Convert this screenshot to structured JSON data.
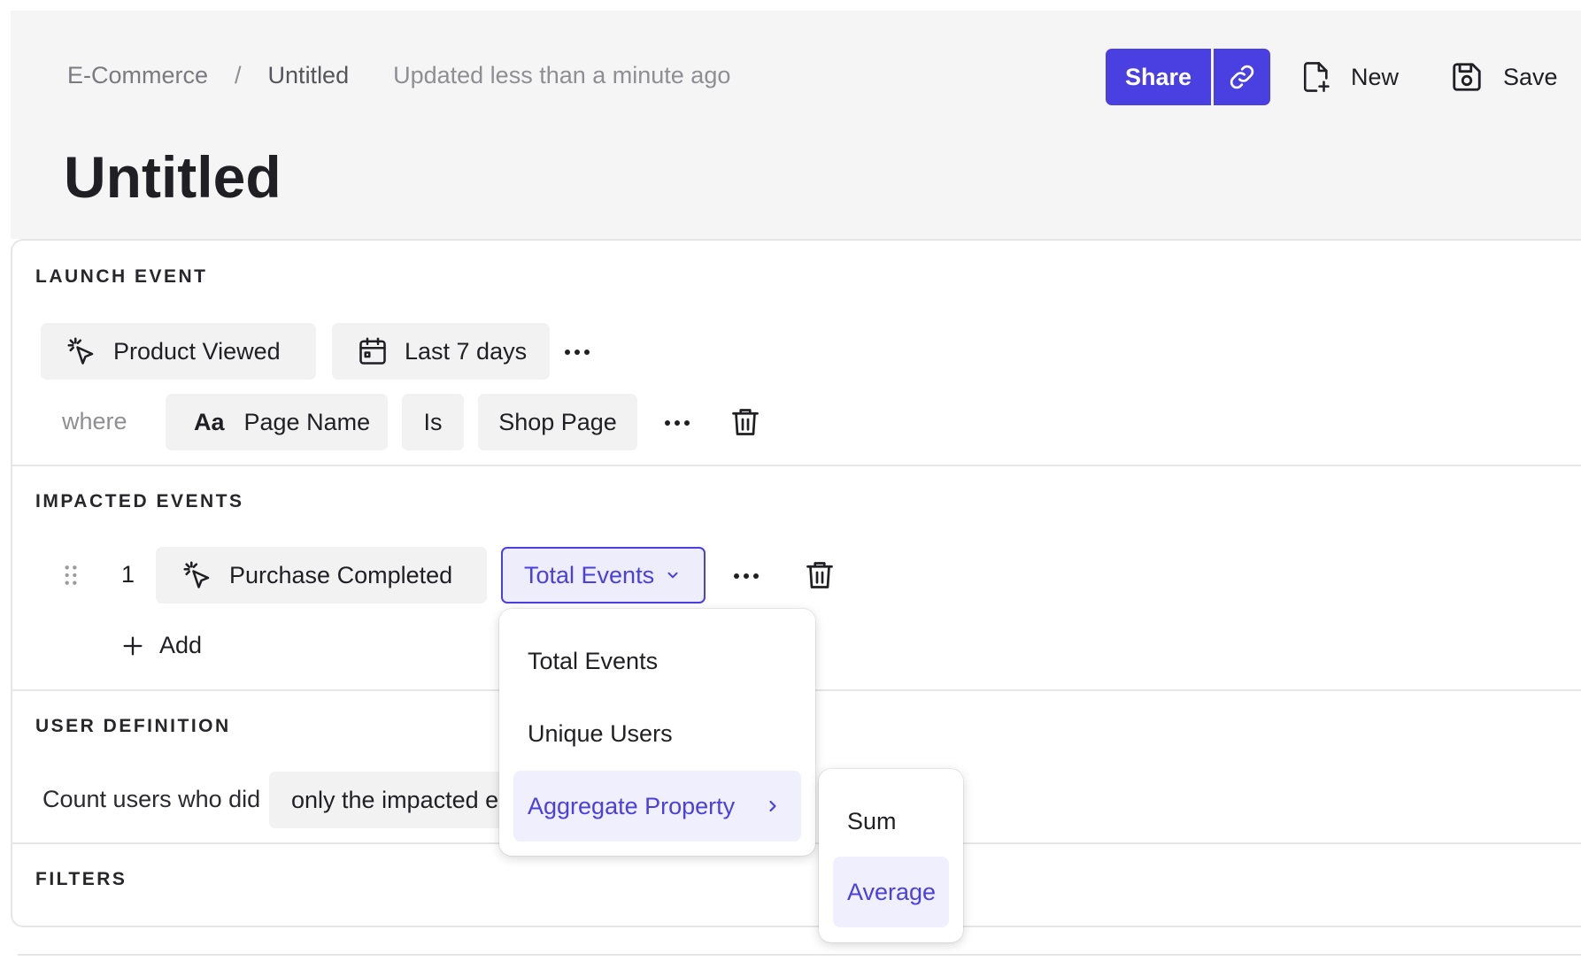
{
  "breadcrumb": {
    "root": "E-Commerce",
    "separator": "/",
    "current": "Untitled",
    "updated": "Updated less than a minute ago"
  },
  "page": {
    "title": "Untitled"
  },
  "header_actions": {
    "share": "Share",
    "new": "New",
    "save": "Save"
  },
  "launch_event": {
    "heading": "LAUNCH EVENT",
    "event": "Product Viewed",
    "date_range": "Last 7 days",
    "filter": {
      "where": "where",
      "type_glyph": "Aa",
      "property": "Page Name",
      "operator": "Is",
      "value": "Shop Page"
    }
  },
  "impacted_events": {
    "heading": "IMPACTED EVENTS",
    "rows": [
      {
        "index": "1",
        "event": "Purchase Completed",
        "measure": "Total Events"
      }
    ],
    "add_label": "Add"
  },
  "user_definition": {
    "heading": "USER DEFINITION",
    "prefix": "Count users who did",
    "value": "only the impacted e"
  },
  "filters": {
    "heading": "FILTERS"
  },
  "measure_menu": {
    "items": [
      "Total Events",
      "Unique Users",
      "Aggregate Property"
    ],
    "active": "Aggregate Property"
  },
  "aggregate_submenu": {
    "items": [
      "Sum",
      "Average"
    ],
    "active": "Average"
  },
  "colors": {
    "accent": "#4a3fe0",
    "chip_bg": "#f2f2f3",
    "header_bg": "#f5f5f5"
  }
}
